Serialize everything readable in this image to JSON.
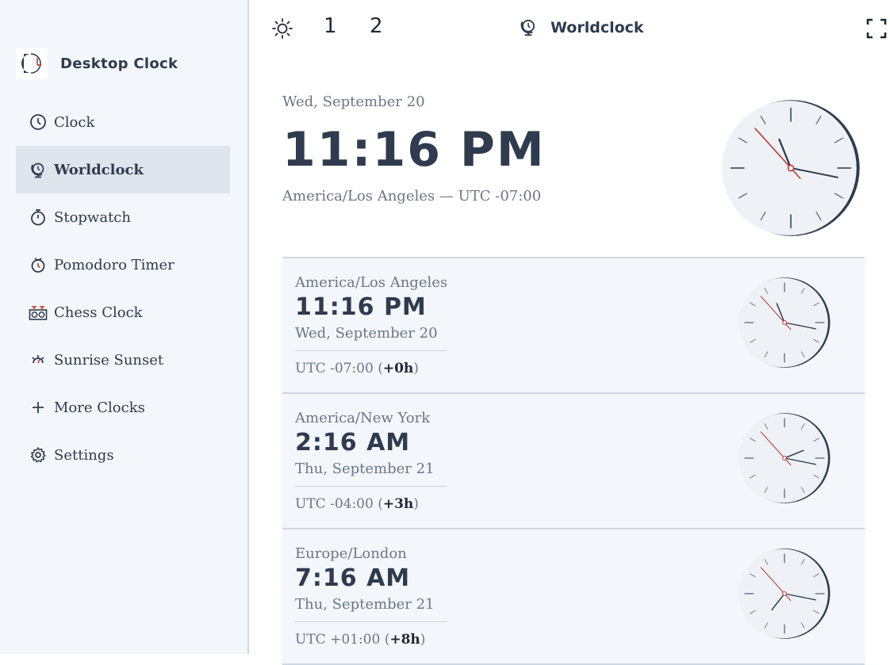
{
  "sidebar": {
    "brand": "Desktop Clock",
    "items": [
      {
        "label": "Clock",
        "icon": "clock-icon",
        "active": false
      },
      {
        "label": "Worldclock",
        "icon": "globe-clock-icon",
        "active": true
      },
      {
        "label": "Stopwatch",
        "icon": "stopwatch-icon",
        "active": false
      },
      {
        "label": "Pomodoro Timer",
        "icon": "pomodoro-icon",
        "active": false
      },
      {
        "label": "Chess Clock",
        "icon": "chess-clock-icon",
        "active": false
      },
      {
        "label": "Sunrise Sunset",
        "icon": "sunrise-icon",
        "active": false
      },
      {
        "label": "More Clocks",
        "icon": "plus-icon",
        "active": false
      },
      {
        "label": "Settings",
        "icon": "gear-icon",
        "active": false
      }
    ]
  },
  "topbar": {
    "layout1": "1",
    "layout2": "2",
    "title": "Worldclock"
  },
  "main": {
    "date": "Wed, September 20",
    "time": "11:16 PM",
    "zone": "America/Los Angeles — UTC -07:00"
  },
  "cards": [
    {
      "name": "America/Los Angeles",
      "time": "11:16 PM",
      "date": "Wed, September 20",
      "utc": "UTC -07:00",
      "diff": "+0h"
    },
    {
      "name": "America/New York",
      "time": "2:16 AM",
      "date": "Thu, September 21",
      "utc": "UTC -04:00",
      "diff": "+3h"
    },
    {
      "name": "Europe/London",
      "time": "7:16 AM",
      "date": "Thu, September 21",
      "utc": "UTC +01:00",
      "diff": "+8h"
    }
  ],
  "colors": {
    "accent": "#c0392b",
    "text": "#2f3b4f",
    "sidebar_bg": "#f3f6fa",
    "active_bg": "#dfe5ed"
  }
}
